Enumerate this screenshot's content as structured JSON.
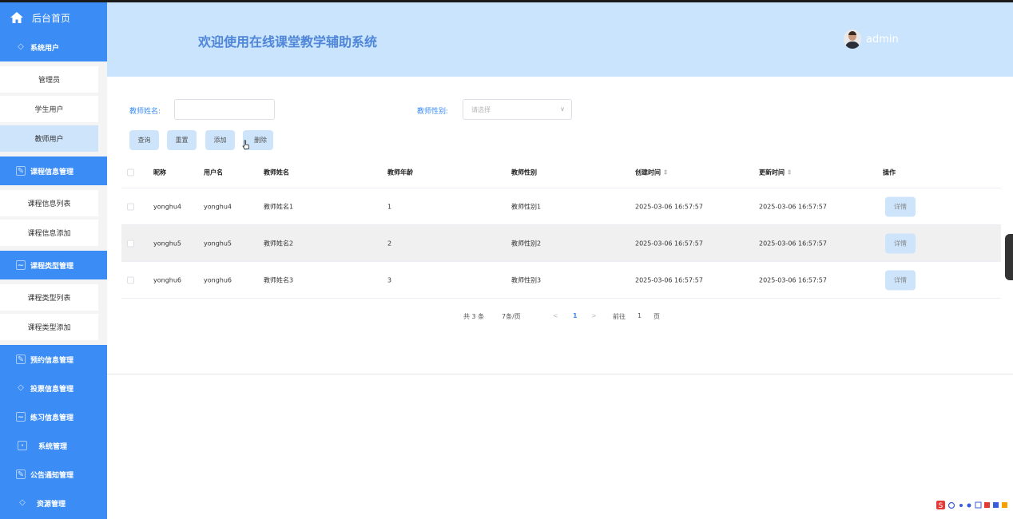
{
  "sidebar": {
    "home": "后台首页",
    "groups": {
      "system_users": "系统用户",
      "course_info": "课程信息管理",
      "course_type": "课程类型管理",
      "booking": "预约信息管理",
      "vote": "投票信息管理",
      "practice": "练习信息管理",
      "system": "系统管理",
      "notice": "公告通知管理",
      "resource": "资源管理"
    },
    "items": {
      "admin": "管理员",
      "student": "学生用户",
      "teacher": "教师用户",
      "course_info_list": "课程信息列表",
      "course_info_add": "课程信息添加",
      "course_type_list": "课程类型列表",
      "course_type_add": "课程类型添加"
    }
  },
  "header": {
    "title": "欢迎使用在线课堂教学辅助系统",
    "username": "admin"
  },
  "search": {
    "name_label": "教师姓名:",
    "gender_label": "教师性别:",
    "gender_placeholder": "请选择",
    "gender_arrow": "∨"
  },
  "toolbar": {
    "query": "查询",
    "reset": "重置",
    "add": "添加",
    "delete": "删除"
  },
  "table": {
    "headers": {
      "nickname": "昵称",
      "username": "用户名",
      "name": "教师姓名",
      "age": "教师年龄",
      "gender": "教师性别",
      "created": "创建时间",
      "updated": "更新时间",
      "action": "操作"
    },
    "sort_icon": "⇕",
    "rows": [
      {
        "nickname": "yonghu4",
        "username": "yonghu4",
        "name": "教师姓名1",
        "age": "1",
        "gender": "教师性别1",
        "created": "2025-03-06 16:57:57",
        "updated": "2025-03-06 16:57:57",
        "action": "详情"
      },
      {
        "nickname": "yonghu5",
        "username": "yonghu5",
        "name": "教师姓名2",
        "age": "2",
        "gender": "教师性别2",
        "created": "2025-03-06 16:57:57",
        "updated": "2025-03-06 16:57:57",
        "action": "详情"
      },
      {
        "nickname": "yonghu6",
        "username": "yonghu6",
        "name": "教师姓名3",
        "age": "3",
        "gender": "教师性别3",
        "created": "2025-03-06 16:57:57",
        "updated": "2025-03-06 16:57:57",
        "action": "详情"
      }
    ]
  },
  "pagination": {
    "total": "共 3 条",
    "page_size": "7条/页",
    "size_arrow": "∨",
    "prev": "<",
    "current": "1",
    "next": ">",
    "goto": "前往",
    "goto_page": "1",
    "page_unit": "页"
  },
  "colors": {
    "sidebar_blue": "#3b8cf5",
    "header_bg": "#c9e4fc",
    "button_bg": "#cde4fb",
    "title_text": "#4f86d9"
  }
}
